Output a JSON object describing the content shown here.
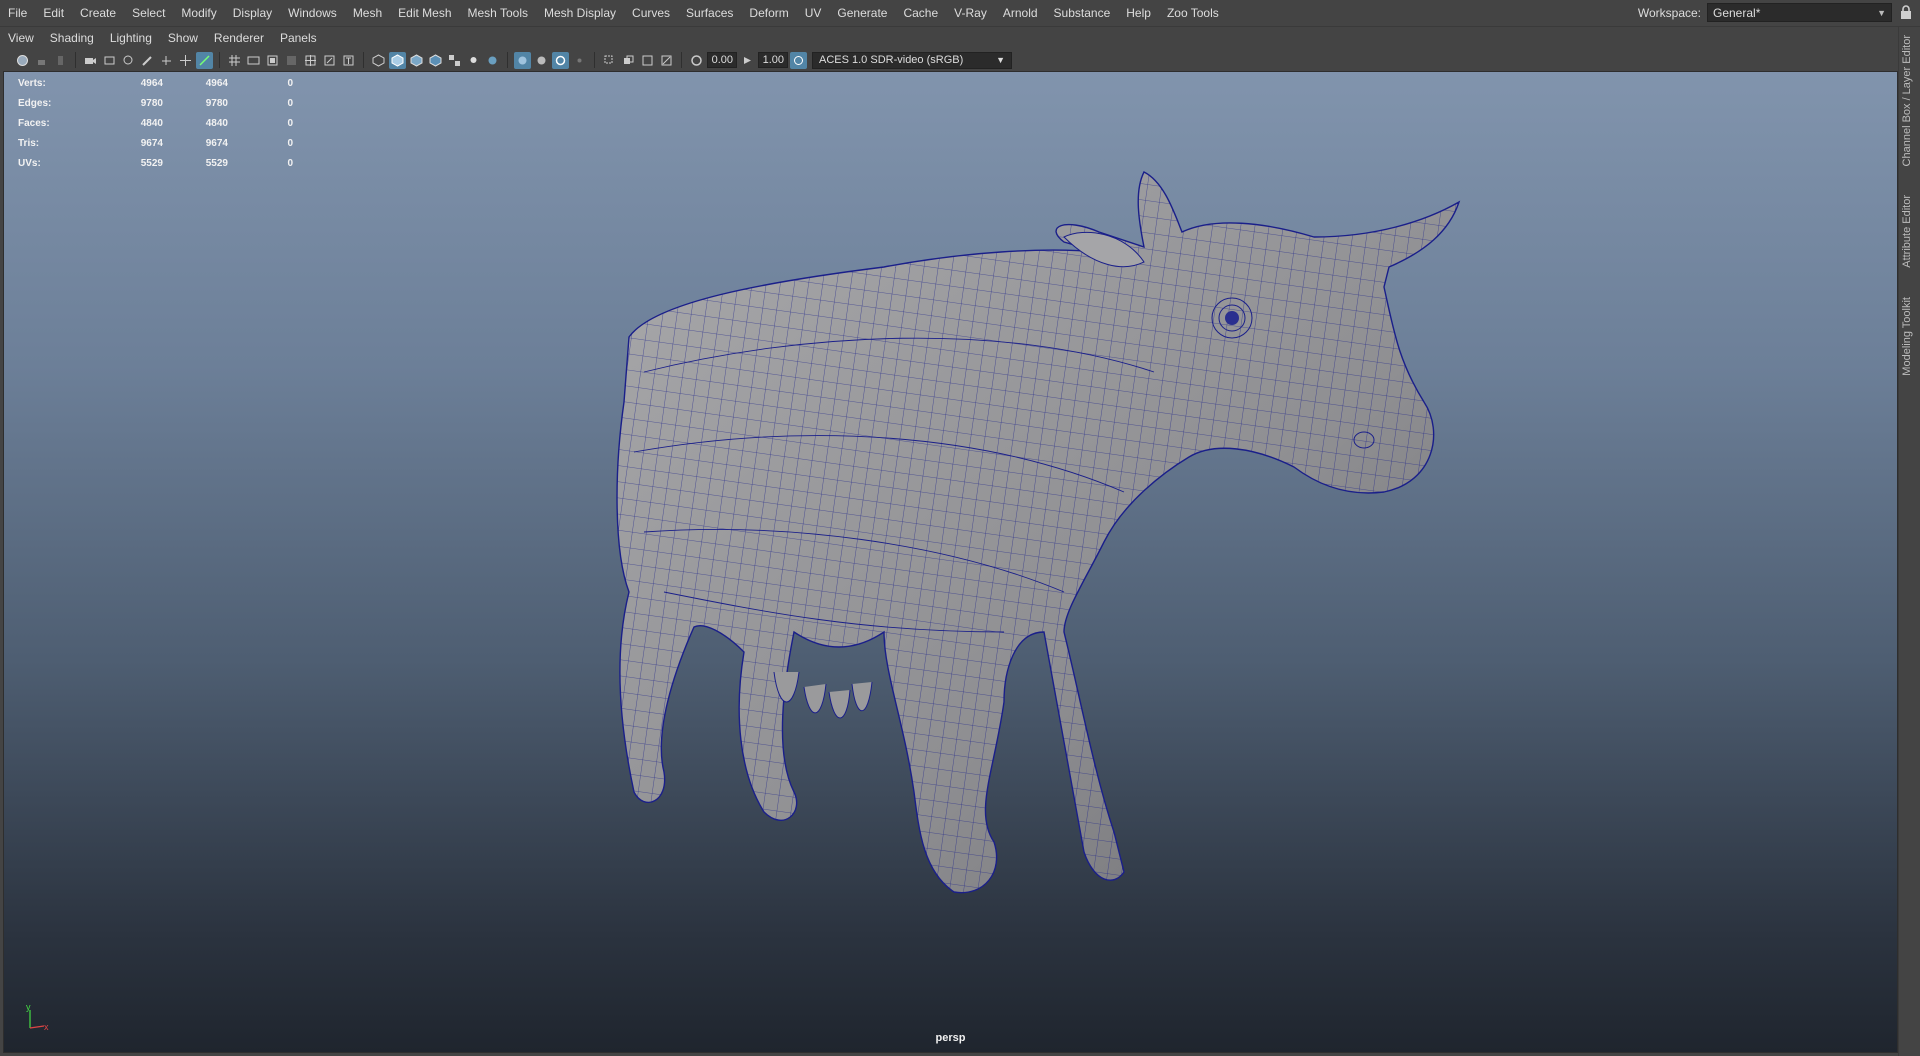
{
  "menubar": {
    "items": [
      "File",
      "Edit",
      "Create",
      "Select",
      "Modify",
      "Display",
      "Windows",
      "Mesh",
      "Edit Mesh",
      "Mesh Tools",
      "Mesh Display",
      "Curves",
      "Surfaces",
      "Deform",
      "UV",
      "Generate",
      "Cache",
      "V-Ray",
      "Arnold",
      "Substance",
      "Help",
      "Zoo Tools"
    ],
    "workspace_label": "Workspace:",
    "workspace_value": "General*"
  },
  "side_tabs": [
    "Channel Box / Layer Editor",
    "Attribute Editor",
    "Modeling Toolkit"
  ],
  "panel": {
    "menus": [
      "View",
      "Shading",
      "Lighting",
      "Show",
      "Renderer",
      "Panels"
    ],
    "exposure": "0.00",
    "gamma": "1.00",
    "color_space": "ACES 1.0 SDR-video (sRGB)"
  },
  "hud": {
    "rows": [
      {
        "label": "Verts:",
        "a": "4964",
        "b": "4964",
        "c": "0"
      },
      {
        "label": "Edges:",
        "a": "9780",
        "b": "9780",
        "c": "0"
      },
      {
        "label": "Faces:",
        "a": "4840",
        "b": "4840",
        "c": "0"
      },
      {
        "label": "Tris:",
        "a": "9674",
        "b": "9674",
        "c": "0"
      },
      {
        "label": "UVs:",
        "a": "5529",
        "b": "5529",
        "c": "0"
      }
    ]
  },
  "viewport": {
    "camera": "persp",
    "axis_y": "y",
    "axis_x": "x"
  },
  "colors": {
    "accent": "#5285a6",
    "wire": "#1a1f8a",
    "mesh": "#9a9a9c"
  }
}
